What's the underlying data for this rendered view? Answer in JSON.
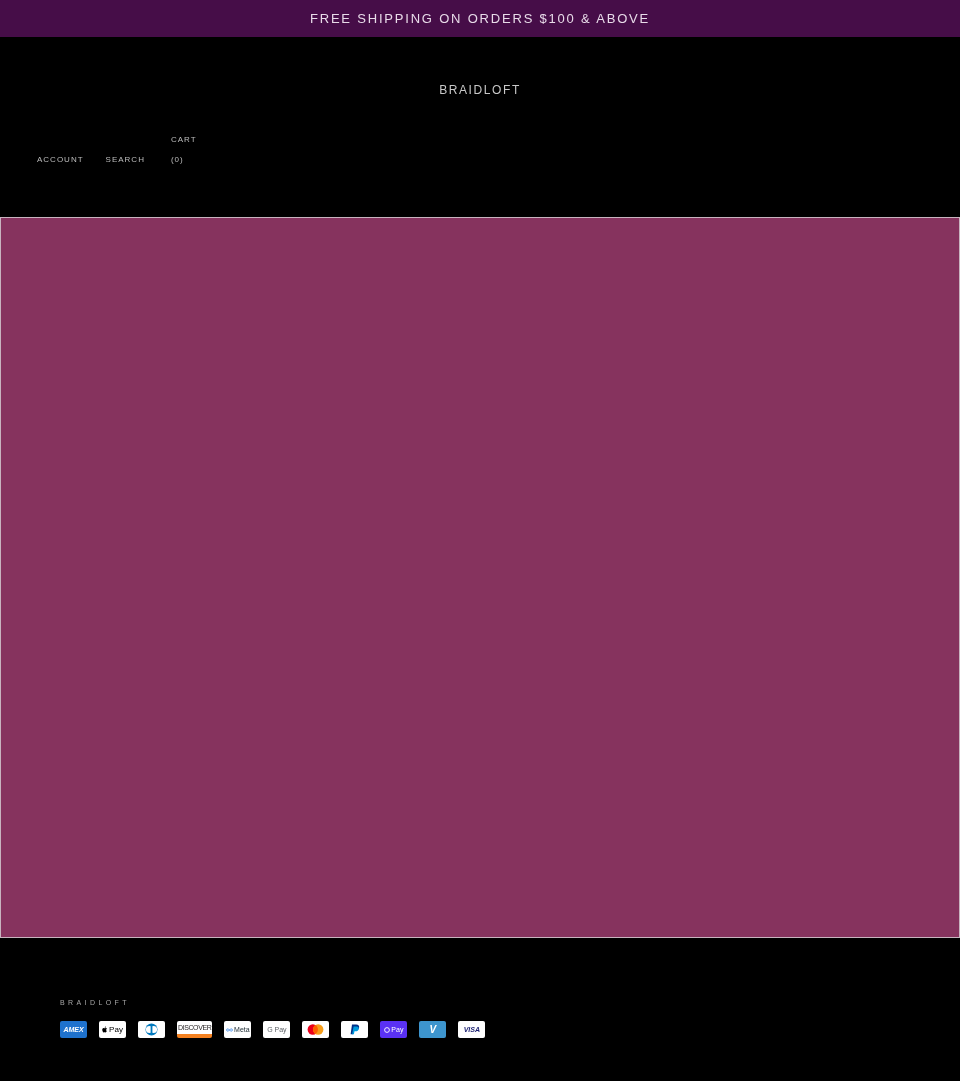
{
  "announcement": {
    "text": "FREE SHIPPING ON ORDERS $100 & ABOVE"
  },
  "header": {
    "logo": "BRAIDLOFT",
    "links": [
      {
        "kind": "account",
        "label": "ACCOUNT"
      },
      {
        "kind": "search",
        "label": "SEARCH"
      },
      {
        "kind": "cart",
        "label": "CART",
        "count": "(0)"
      }
    ]
  },
  "footer": {
    "brand": "BRAIDLOFT",
    "payment_methods": [
      {
        "kind": "amex",
        "label": "AMEX"
      },
      {
        "kind": "apple_pay",
        "label": "Pay"
      },
      {
        "kind": "diners"
      },
      {
        "kind": "discover",
        "label": "DISCOVER"
      },
      {
        "kind": "meta",
        "label": "Meta"
      },
      {
        "kind": "google_pay",
        "label": "G Pay"
      },
      {
        "kind": "mastercard"
      },
      {
        "kind": "paypal"
      },
      {
        "kind": "shop_pay",
        "label": "Pay"
      },
      {
        "kind": "venmo",
        "label": "V"
      },
      {
        "kind": "visa",
        "label": "VISA"
      }
    ]
  }
}
